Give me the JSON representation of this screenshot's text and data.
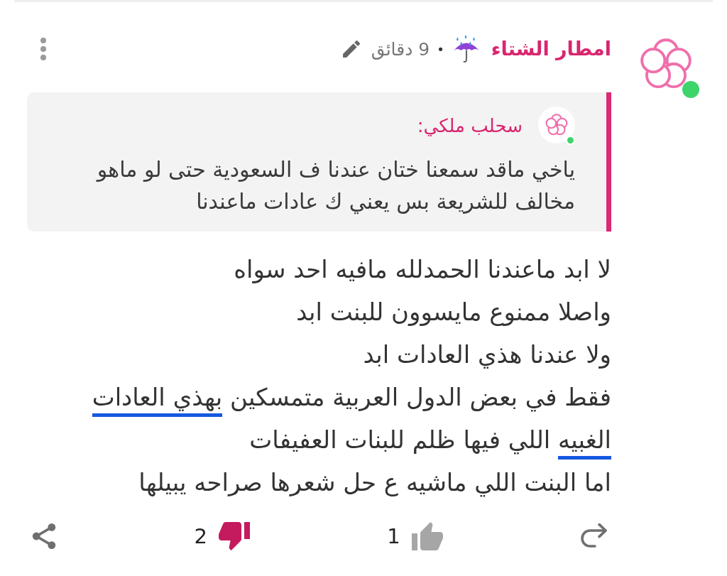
{
  "post": {
    "author": {
      "name": "امطار الشتاء",
      "online": true
    },
    "separator": "•",
    "time": "9 دقائق",
    "quote": {
      "author": "سحلب ملكي:",
      "online": true,
      "text": "ياخي ماقد سمعنا ختان عندنا ف السعودية حتى لو ماهو\nمخالف للشريعة بس يعني ك عادات ماعندنا"
    },
    "lines": [
      [
        {
          "text": "لا ابد ماعندنا الحمدلله مافيه احد سواه",
          "underlined": false
        }
      ],
      [
        {
          "text": "واصلا ممنوع مايسوون للبنت ابد",
          "underlined": false
        }
      ],
      [
        {
          "text": "ولا عندنا هذي العادات ابد",
          "underlined": false
        }
      ],
      [
        {
          "text": "فقط في بعض الدول العربية متمسكين ",
          "underlined": false
        },
        {
          "text": "بهذي العادات",
          "underlined": true
        }
      ],
      [
        {
          "text": "الغبيه",
          "underlined": true
        },
        {
          "text": " اللي فيها ظلم للبنات العفيفات",
          "underlined": false
        }
      ],
      [
        {
          "text": "اما البنت اللي ماشيه ع حل شعرها صراحه يبيلها",
          "underlined": false
        }
      ]
    ],
    "reactions": [
      {
        "kind": "like",
        "count": "1",
        "selected": false
      },
      {
        "kind": "dislike",
        "count": "2",
        "selected": true
      }
    ]
  }
}
